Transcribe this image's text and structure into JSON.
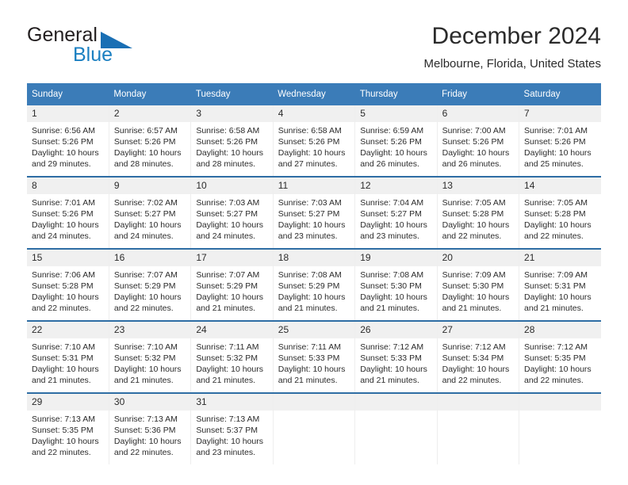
{
  "brand": {
    "name_part1": "General",
    "name_part2": "Blue",
    "triangle_color": "#1a6fb4",
    "text_color_part1": "#231f20",
    "text_color_part2": "#1a7fc1"
  },
  "header": {
    "title": "December 2024",
    "subtitle": "Melbourne, Florida, United States"
  },
  "theme": {
    "header_row_bg": "#3b7cb8",
    "header_row_text": "#ffffff",
    "daynum_bg": "#f0f0f0",
    "row_divider": "#2e6da4",
    "cell_divider": "#eeeeee"
  },
  "weekday_headers": [
    "Sunday",
    "Monday",
    "Tuesday",
    "Wednesday",
    "Thursday",
    "Friday",
    "Saturday"
  ],
  "labels": {
    "sunrise_prefix": "Sunrise:",
    "sunset_prefix": "Sunset:",
    "daylight_prefix": "Daylight:"
  },
  "weeks": [
    [
      {
        "day": "1",
        "sunrise": "Sunrise: 6:56 AM",
        "sunset": "Sunset: 5:26 PM",
        "daylight_line1": "Daylight: 10 hours",
        "daylight_line2": "and 29 minutes."
      },
      {
        "day": "2",
        "sunrise": "Sunrise: 6:57 AM",
        "sunset": "Sunset: 5:26 PM",
        "daylight_line1": "Daylight: 10 hours",
        "daylight_line2": "and 28 minutes."
      },
      {
        "day": "3",
        "sunrise": "Sunrise: 6:58 AM",
        "sunset": "Sunset: 5:26 PM",
        "daylight_line1": "Daylight: 10 hours",
        "daylight_line2": "and 28 minutes."
      },
      {
        "day": "4",
        "sunrise": "Sunrise: 6:58 AM",
        "sunset": "Sunset: 5:26 PM",
        "daylight_line1": "Daylight: 10 hours",
        "daylight_line2": "and 27 minutes."
      },
      {
        "day": "5",
        "sunrise": "Sunrise: 6:59 AM",
        "sunset": "Sunset: 5:26 PM",
        "daylight_line1": "Daylight: 10 hours",
        "daylight_line2": "and 26 minutes."
      },
      {
        "day": "6",
        "sunrise": "Sunrise: 7:00 AM",
        "sunset": "Sunset: 5:26 PM",
        "daylight_line1": "Daylight: 10 hours",
        "daylight_line2": "and 26 minutes."
      },
      {
        "day": "7",
        "sunrise": "Sunrise: 7:01 AM",
        "sunset": "Sunset: 5:26 PM",
        "daylight_line1": "Daylight: 10 hours",
        "daylight_line2": "and 25 minutes."
      }
    ],
    [
      {
        "day": "8",
        "sunrise": "Sunrise: 7:01 AM",
        "sunset": "Sunset: 5:26 PM",
        "daylight_line1": "Daylight: 10 hours",
        "daylight_line2": "and 24 minutes."
      },
      {
        "day": "9",
        "sunrise": "Sunrise: 7:02 AM",
        "sunset": "Sunset: 5:27 PM",
        "daylight_line1": "Daylight: 10 hours",
        "daylight_line2": "and 24 minutes."
      },
      {
        "day": "10",
        "sunrise": "Sunrise: 7:03 AM",
        "sunset": "Sunset: 5:27 PM",
        "daylight_line1": "Daylight: 10 hours",
        "daylight_line2": "and 24 minutes."
      },
      {
        "day": "11",
        "sunrise": "Sunrise: 7:03 AM",
        "sunset": "Sunset: 5:27 PM",
        "daylight_line1": "Daylight: 10 hours",
        "daylight_line2": "and 23 minutes."
      },
      {
        "day": "12",
        "sunrise": "Sunrise: 7:04 AM",
        "sunset": "Sunset: 5:27 PM",
        "daylight_line1": "Daylight: 10 hours",
        "daylight_line2": "and 23 minutes."
      },
      {
        "day": "13",
        "sunrise": "Sunrise: 7:05 AM",
        "sunset": "Sunset: 5:28 PM",
        "daylight_line1": "Daylight: 10 hours",
        "daylight_line2": "and 22 minutes."
      },
      {
        "day": "14",
        "sunrise": "Sunrise: 7:05 AM",
        "sunset": "Sunset: 5:28 PM",
        "daylight_line1": "Daylight: 10 hours",
        "daylight_line2": "and 22 minutes."
      }
    ],
    [
      {
        "day": "15",
        "sunrise": "Sunrise: 7:06 AM",
        "sunset": "Sunset: 5:28 PM",
        "daylight_line1": "Daylight: 10 hours",
        "daylight_line2": "and 22 minutes."
      },
      {
        "day": "16",
        "sunrise": "Sunrise: 7:07 AM",
        "sunset": "Sunset: 5:29 PM",
        "daylight_line1": "Daylight: 10 hours",
        "daylight_line2": "and 22 minutes."
      },
      {
        "day": "17",
        "sunrise": "Sunrise: 7:07 AM",
        "sunset": "Sunset: 5:29 PM",
        "daylight_line1": "Daylight: 10 hours",
        "daylight_line2": "and 21 minutes."
      },
      {
        "day": "18",
        "sunrise": "Sunrise: 7:08 AM",
        "sunset": "Sunset: 5:29 PM",
        "daylight_line1": "Daylight: 10 hours",
        "daylight_line2": "and 21 minutes."
      },
      {
        "day": "19",
        "sunrise": "Sunrise: 7:08 AM",
        "sunset": "Sunset: 5:30 PM",
        "daylight_line1": "Daylight: 10 hours",
        "daylight_line2": "and 21 minutes."
      },
      {
        "day": "20",
        "sunrise": "Sunrise: 7:09 AM",
        "sunset": "Sunset: 5:30 PM",
        "daylight_line1": "Daylight: 10 hours",
        "daylight_line2": "and 21 minutes."
      },
      {
        "day": "21",
        "sunrise": "Sunrise: 7:09 AM",
        "sunset": "Sunset: 5:31 PM",
        "daylight_line1": "Daylight: 10 hours",
        "daylight_line2": "and 21 minutes."
      }
    ],
    [
      {
        "day": "22",
        "sunrise": "Sunrise: 7:10 AM",
        "sunset": "Sunset: 5:31 PM",
        "daylight_line1": "Daylight: 10 hours",
        "daylight_line2": "and 21 minutes."
      },
      {
        "day": "23",
        "sunrise": "Sunrise: 7:10 AM",
        "sunset": "Sunset: 5:32 PM",
        "daylight_line1": "Daylight: 10 hours",
        "daylight_line2": "and 21 minutes."
      },
      {
        "day": "24",
        "sunrise": "Sunrise: 7:11 AM",
        "sunset": "Sunset: 5:32 PM",
        "daylight_line1": "Daylight: 10 hours",
        "daylight_line2": "and 21 minutes."
      },
      {
        "day": "25",
        "sunrise": "Sunrise: 7:11 AM",
        "sunset": "Sunset: 5:33 PM",
        "daylight_line1": "Daylight: 10 hours",
        "daylight_line2": "and 21 minutes."
      },
      {
        "day": "26",
        "sunrise": "Sunrise: 7:12 AM",
        "sunset": "Sunset: 5:33 PM",
        "daylight_line1": "Daylight: 10 hours",
        "daylight_line2": "and 21 minutes."
      },
      {
        "day": "27",
        "sunrise": "Sunrise: 7:12 AM",
        "sunset": "Sunset: 5:34 PM",
        "daylight_line1": "Daylight: 10 hours",
        "daylight_line2": "and 22 minutes."
      },
      {
        "day": "28",
        "sunrise": "Sunrise: 7:12 AM",
        "sunset": "Sunset: 5:35 PM",
        "daylight_line1": "Daylight: 10 hours",
        "daylight_line2": "and 22 minutes."
      }
    ],
    [
      {
        "day": "29",
        "sunrise": "Sunrise: 7:13 AM",
        "sunset": "Sunset: 5:35 PM",
        "daylight_line1": "Daylight: 10 hours",
        "daylight_line2": "and 22 minutes."
      },
      {
        "day": "30",
        "sunrise": "Sunrise: 7:13 AM",
        "sunset": "Sunset: 5:36 PM",
        "daylight_line1": "Daylight: 10 hours",
        "daylight_line2": "and 22 minutes."
      },
      {
        "day": "31",
        "sunrise": "Sunrise: 7:13 AM",
        "sunset": "Sunset: 5:37 PM",
        "daylight_line1": "Daylight: 10 hours",
        "daylight_line2": "and 23 minutes."
      },
      {
        "day": "",
        "sunrise": "",
        "sunset": "",
        "daylight_line1": "",
        "daylight_line2": ""
      },
      {
        "day": "",
        "sunrise": "",
        "sunset": "",
        "daylight_line1": "",
        "daylight_line2": ""
      },
      {
        "day": "",
        "sunrise": "",
        "sunset": "",
        "daylight_line1": "",
        "daylight_line2": ""
      },
      {
        "day": "",
        "sunrise": "",
        "sunset": "",
        "daylight_line1": "",
        "daylight_line2": ""
      }
    ]
  ]
}
